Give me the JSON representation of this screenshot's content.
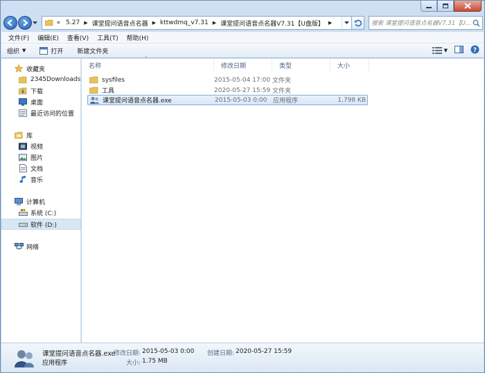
{
  "window": {
    "minimize_label": "—",
    "maximize_label": "□",
    "close_label": "✕"
  },
  "address": {
    "overflow": "«",
    "crumbs": [
      "5.27",
      "课堂提问语音点名器",
      "kttwdmq_v7.31",
      "课堂提问语音点名器V7.31【U盘版】"
    ]
  },
  "search": {
    "placeholder": "搜索 课堂提问语音点名器V7.31【U..."
  },
  "menu": [
    "文件(F)",
    "编辑(E)",
    "查看(V)",
    "工具(T)",
    "帮助(H)"
  ],
  "toolbar": {
    "organize": "组织",
    "open": "打开",
    "new_folder": "新建文件夹"
  },
  "nav": {
    "favorites": "收藏夹",
    "fav_items": [
      "2345Downloads",
      "下载",
      "桌面",
      "最近访问的位置"
    ],
    "libraries": "库",
    "lib_items": [
      "视频",
      "图片",
      "文档",
      "音乐"
    ],
    "computer": "计算机",
    "drives": [
      "系统 (C:)",
      "软件 (D:)"
    ],
    "network": "网络"
  },
  "columns": {
    "name": "名称",
    "date": "修改日期",
    "type": "类型",
    "size": "大小"
  },
  "files": [
    {
      "name": "sysfiles",
      "date": "2015-05-04 17:00",
      "type": "文件夹",
      "size": ""
    },
    {
      "name": "工具",
      "date": "2020-05-27 15:59",
      "type": "文件夹",
      "size": ""
    },
    {
      "name": "课堂提问语音点名器.exe",
      "date": "2015-05-03 0:00",
      "type": "应用程序",
      "size": "1,798 KB"
    }
  ],
  "details": {
    "name": "课堂提问语音点名器.exe",
    "type": "应用程序",
    "modified_label": "修改日期:",
    "modified": "2015-05-03 0:00",
    "size_label": "大小:",
    "size": "1.75 MB",
    "created_label": "创建日期:",
    "created": "2020-05-27 15:59"
  },
  "colors": {
    "accent": "#1f5fb5",
    "folder": "#e8c25a",
    "selection": "#d6e7fa"
  }
}
